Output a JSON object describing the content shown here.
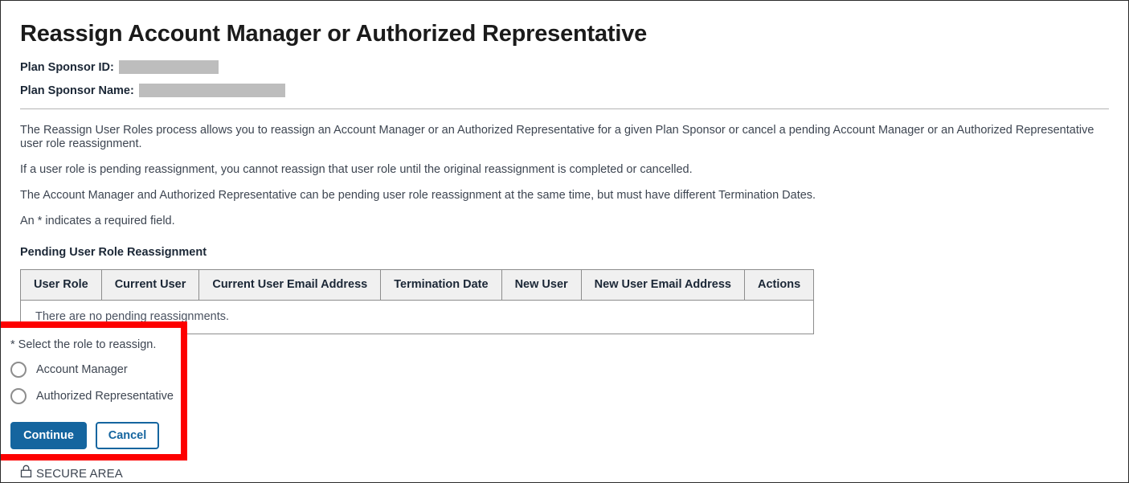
{
  "page": {
    "title": "Reassign Account Manager or Authorized Representative"
  },
  "meta": {
    "plan_sponsor_id_label": "Plan Sponsor ID:",
    "plan_sponsor_id_value": "",
    "plan_sponsor_name_label": "Plan Sponsor Name:",
    "plan_sponsor_name_value": ""
  },
  "intro": {
    "paragraph1": "The Reassign User Roles process allows you to reassign an Account Manager or an Authorized Representative for a given Plan Sponsor or cancel a pending Account Manager or an Authorized Representative user role reassignment.",
    "paragraph2": "If a user role is pending reassignment, you cannot reassign that user role until the original reassignment is completed or cancelled.",
    "paragraph3": "The Account Manager and Authorized Representative can be pending user role reassignment at the same time, but must have different Termination Dates.",
    "paragraph4": "An * indicates a required field."
  },
  "pending_table": {
    "heading": "Pending User Role Reassignment",
    "columns": [
      "User Role",
      "Current User",
      "Current User Email Address",
      "Termination Date",
      "New User",
      "New User Email Address",
      "Actions"
    ],
    "empty_message": "There are no pending reassignments.",
    "rows": []
  },
  "role_selection": {
    "legend": "* Select the role to reassign.",
    "options": [
      {
        "label": "Account Manager",
        "selected": false
      },
      {
        "label": "Authorized Representative",
        "selected": false
      }
    ],
    "continue_label": "Continue",
    "cancel_label": "Cancel",
    "highlight_color": "#fd0000"
  },
  "footer": {
    "secure_area_label": "SECURE AREA",
    "lock_icon": "lock-icon"
  },
  "colors": {
    "primary_blue": "#15659f",
    "header_bg": "#f0f0f0",
    "border_gray": "#8d8d8d",
    "redaction_gray": "#bdbdbd",
    "text": "#3d4551",
    "highlight_red": "#fd0000"
  }
}
